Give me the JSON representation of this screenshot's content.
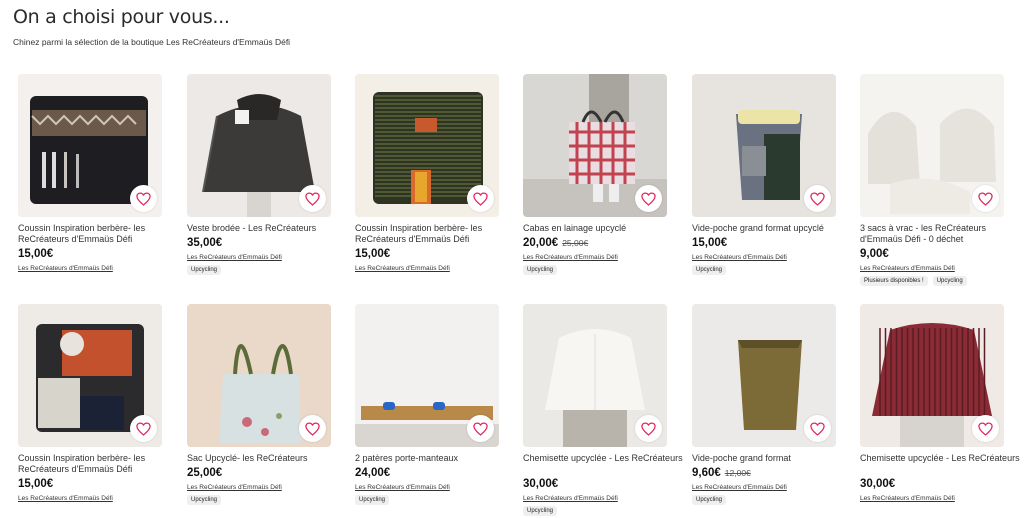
{
  "header": {
    "title": "On a choisi pour vous...",
    "subtitle": "Chinez parmi la sélection de la boutique Les ReCréateurs d'Emmaüs Défi"
  },
  "icons": {
    "favorite": "heart-outline-icon",
    "accent": "#e0245e"
  },
  "products": [
    {
      "name": "Coussin Inspiration berbère- les ReCréateurs d'Emmaüs Défi",
      "price": "15,00€",
      "old_price": "",
      "shop": "Les ReCréateurs d'Emmaüs Défi",
      "tags": []
    },
    {
      "name": "Veste brodée - Les ReCréateurs",
      "price": "35,00€",
      "old_price": "",
      "shop": "Les ReCréateurs d'Emmaüs Défi",
      "tags": [
        "Upcycling"
      ]
    },
    {
      "name": "Coussin Inspiration berbère- les ReCréateurs d'Emmaüs Défi",
      "price": "15,00€",
      "old_price": "",
      "shop": "Les ReCréateurs d'Emmaüs Défi",
      "tags": []
    },
    {
      "name": "Cabas en lainage upcyclé",
      "price": "20,00€",
      "old_price": "25,00€",
      "shop": "Les ReCréateurs d'Emmaüs Défi",
      "tags": [
        "Upcycling"
      ]
    },
    {
      "name": "Vide-poche grand format upcyclé",
      "price": "15,00€",
      "old_price": "",
      "shop": "Les ReCréateurs d'Emmaüs Défi",
      "tags": [
        "Upcycling"
      ]
    },
    {
      "name": "3 sacs à vrac - les ReCréateurs d'Emmaüs Défi - 0 déchet",
      "price": "9,00€",
      "old_price": "",
      "shop": "Les ReCréateurs d'Emmaüs Défi",
      "tags": [
        "Plusieurs disponibles !",
        "Upcycling"
      ]
    },
    {
      "name": "Coussin Inspiration berbère- les ReCréateurs d'Emmaüs Défi",
      "price": "15,00€",
      "old_price": "",
      "shop": "Les ReCréateurs d'Emmaüs Défi",
      "tags": []
    },
    {
      "name": "Sac Upcyclé- les ReCréateurs",
      "price": "25,00€",
      "old_price": "",
      "shop": "Les ReCréateurs d'Emmaüs Défi",
      "tags": [
        "Upcycling"
      ]
    },
    {
      "name": "2 patères porte-manteaux",
      "price": "24,00€",
      "old_price": "",
      "shop": "Les ReCréateurs d'Emmaüs Défi",
      "tags": [
        "Upcycling"
      ]
    },
    {
      "name": "Chemisette upcyclée - Les ReCréateurs",
      "price": "30,00€",
      "old_price": "",
      "shop": "Les ReCréateurs d'Emmaüs Défi",
      "tags": [
        "Upcycling"
      ]
    },
    {
      "name": "Vide-poche grand format",
      "price": "9,60€",
      "old_price": "12,00€",
      "shop": "Les ReCréateurs d'Emmaüs Défi",
      "tags": [
        "Upcycling"
      ]
    },
    {
      "name": "Chemisette upcyclée - Les ReCréateurs",
      "price": "30,00€",
      "old_price": "",
      "shop": "Les ReCréateurs d'Emmaüs Défi",
      "tags": []
    }
  ]
}
